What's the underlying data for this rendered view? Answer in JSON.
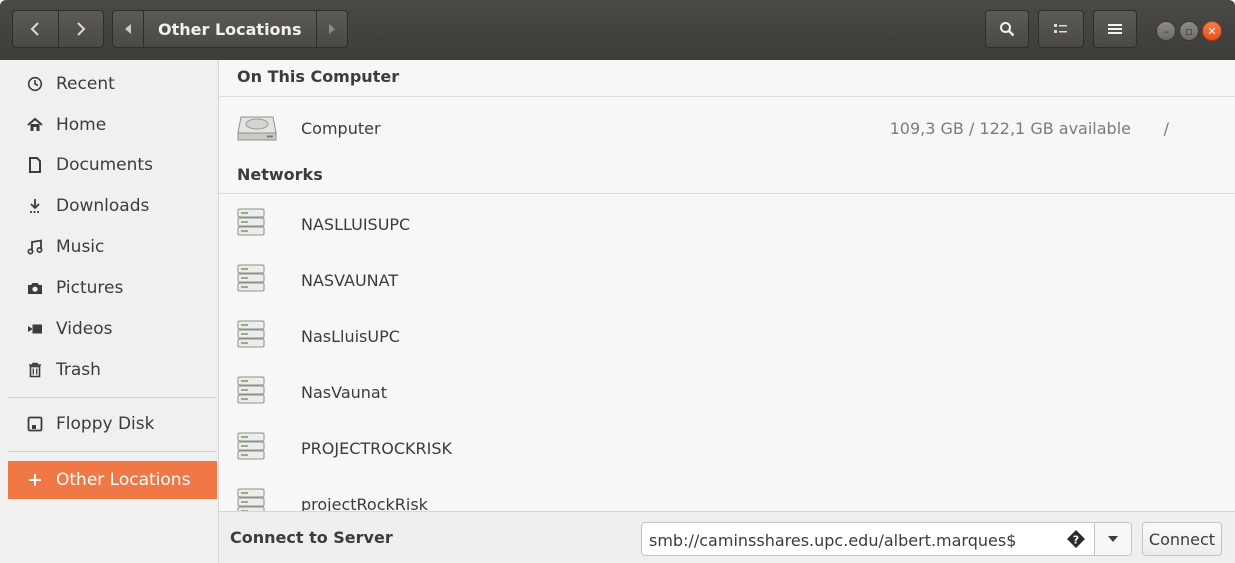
{
  "header": {
    "path_label": "Other Locations"
  },
  "sidebar": {
    "items": [
      {
        "label": "Recent",
        "icon": "clock-icon"
      },
      {
        "label": "Home",
        "icon": "home-icon"
      },
      {
        "label": "Documents",
        "icon": "document-icon"
      },
      {
        "label": "Downloads",
        "icon": "download-icon"
      },
      {
        "label": "Music",
        "icon": "music-icon"
      },
      {
        "label": "Pictures",
        "icon": "camera-icon"
      },
      {
        "label": "Videos",
        "icon": "video-icon"
      },
      {
        "label": "Trash",
        "icon": "trash-icon"
      },
      {
        "label": "Floppy Disk",
        "icon": "floppy-icon"
      },
      {
        "label": "Other Locations",
        "icon": "plus-icon"
      }
    ],
    "active_color": "#f07746"
  },
  "main": {
    "on_this_computer": {
      "title": "On This Computer",
      "computer": {
        "name": "Computer",
        "info": "109,3 GB / 122,1 GB available",
        "path": "/"
      }
    },
    "networks": {
      "title": "Networks",
      "items": [
        "NASLLUISUPC",
        "NASVAUNAT",
        "NasLluisUPC",
        "NasVaunat",
        "PROJECTROCKRISK",
        "projectRockRisk"
      ]
    }
  },
  "bottom": {
    "label": "Connect to Server",
    "server_value": "smb://caminsshares.upc.edu/albert.marques$",
    "connect_label": "Connect"
  }
}
